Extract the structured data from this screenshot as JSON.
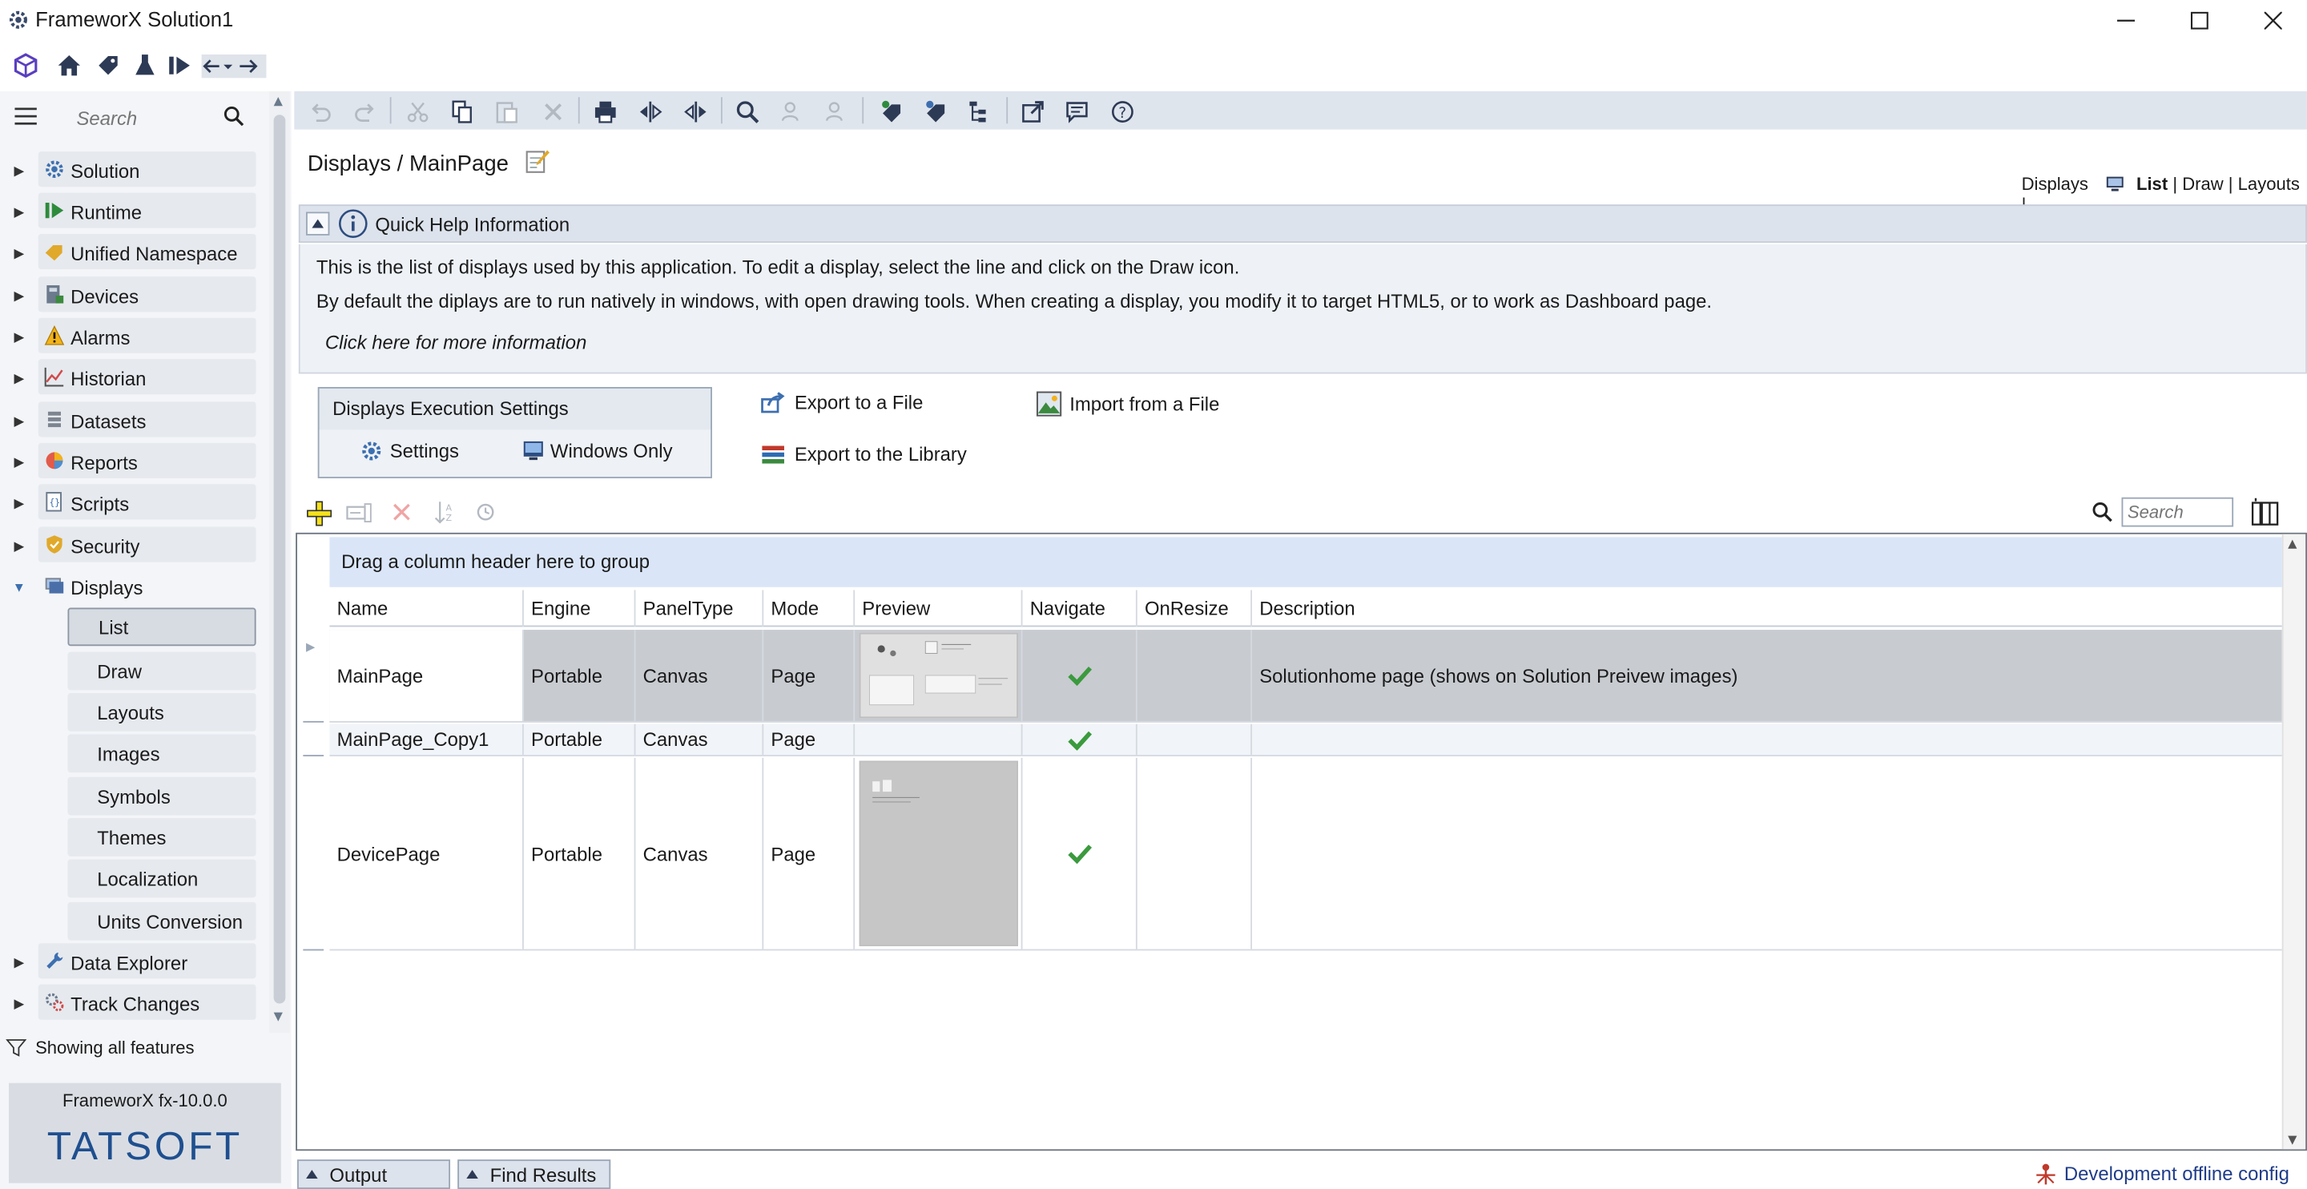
{
  "window": {
    "title": "FrameworX Solution1"
  },
  "sidebar": {
    "search_placeholder": "Search",
    "items": [
      {
        "label": "Solution"
      },
      {
        "label": "Runtime"
      },
      {
        "label": "Unified Namespace"
      },
      {
        "label": "Devices"
      },
      {
        "label": "Alarms"
      },
      {
        "label": "Historian"
      },
      {
        "label": "Datasets"
      },
      {
        "label": "Reports"
      },
      {
        "label": "Scripts"
      },
      {
        "label": "Security"
      },
      {
        "label": "Displays"
      }
    ],
    "displays_children": [
      "List",
      "Draw",
      "Layouts",
      "Images",
      "Symbols",
      "Themes",
      "Localization",
      "Units Conversion"
    ],
    "items_after": [
      {
        "label": "Data Explorer"
      },
      {
        "label": "Track Changes"
      }
    ],
    "filter_text": "Showing all features",
    "version": "FrameworX fx-10.0.0",
    "brand": "TATSOFT"
  },
  "main": {
    "breadcrumb": "Displays / MainPage",
    "view_nav": {
      "prefix": "Displays",
      "list": "List",
      "draw": "Draw",
      "layouts": "Layouts",
      "sep": "|"
    },
    "help": {
      "title": "Quick Help Information",
      "line1": "This is the list of displays used by this application. To edit a display, select the line and click on the Draw icon.",
      "line2": "By default the diplays are to run natively in windows, with open drawing tools. When creating a display, you modify it to target HTML5, or to work as Dashboard page.",
      "more": "Click here for more information"
    },
    "exec": {
      "title": "Displays Execution Settings",
      "settings": "Settings",
      "windows_only": "Windows Only"
    },
    "actions": {
      "export_file": "Export to a File",
      "import_file": "Import from a File",
      "export_library": "Export to the Library"
    },
    "grid_search_placeholder": "Search",
    "grid": {
      "group_hint": "Drag a column header here to group",
      "columns": [
        "Name",
        "Engine",
        "PanelType",
        "Mode",
        "Preview",
        "Navigate",
        "OnResize",
        "Description"
      ],
      "rows": [
        {
          "name": "MainPage",
          "engine": "Portable",
          "panel": "Canvas",
          "mode": "Page",
          "navigate": true,
          "onresize": "",
          "description": "Solutionhome page (shows on Solution Preivew images)"
        },
        {
          "name": "MainPage_Copy1",
          "engine": "Portable",
          "panel": "Canvas",
          "mode": "Page",
          "navigate": true,
          "onresize": "",
          "description": ""
        },
        {
          "name": "DevicePage",
          "engine": "Portable",
          "panel": "Canvas",
          "mode": "Page",
          "navigate": true,
          "onresize": "",
          "description": ""
        }
      ]
    }
  },
  "bottom": {
    "tabs": [
      "Output",
      "Find Results"
    ],
    "status": "Development offline config"
  }
}
